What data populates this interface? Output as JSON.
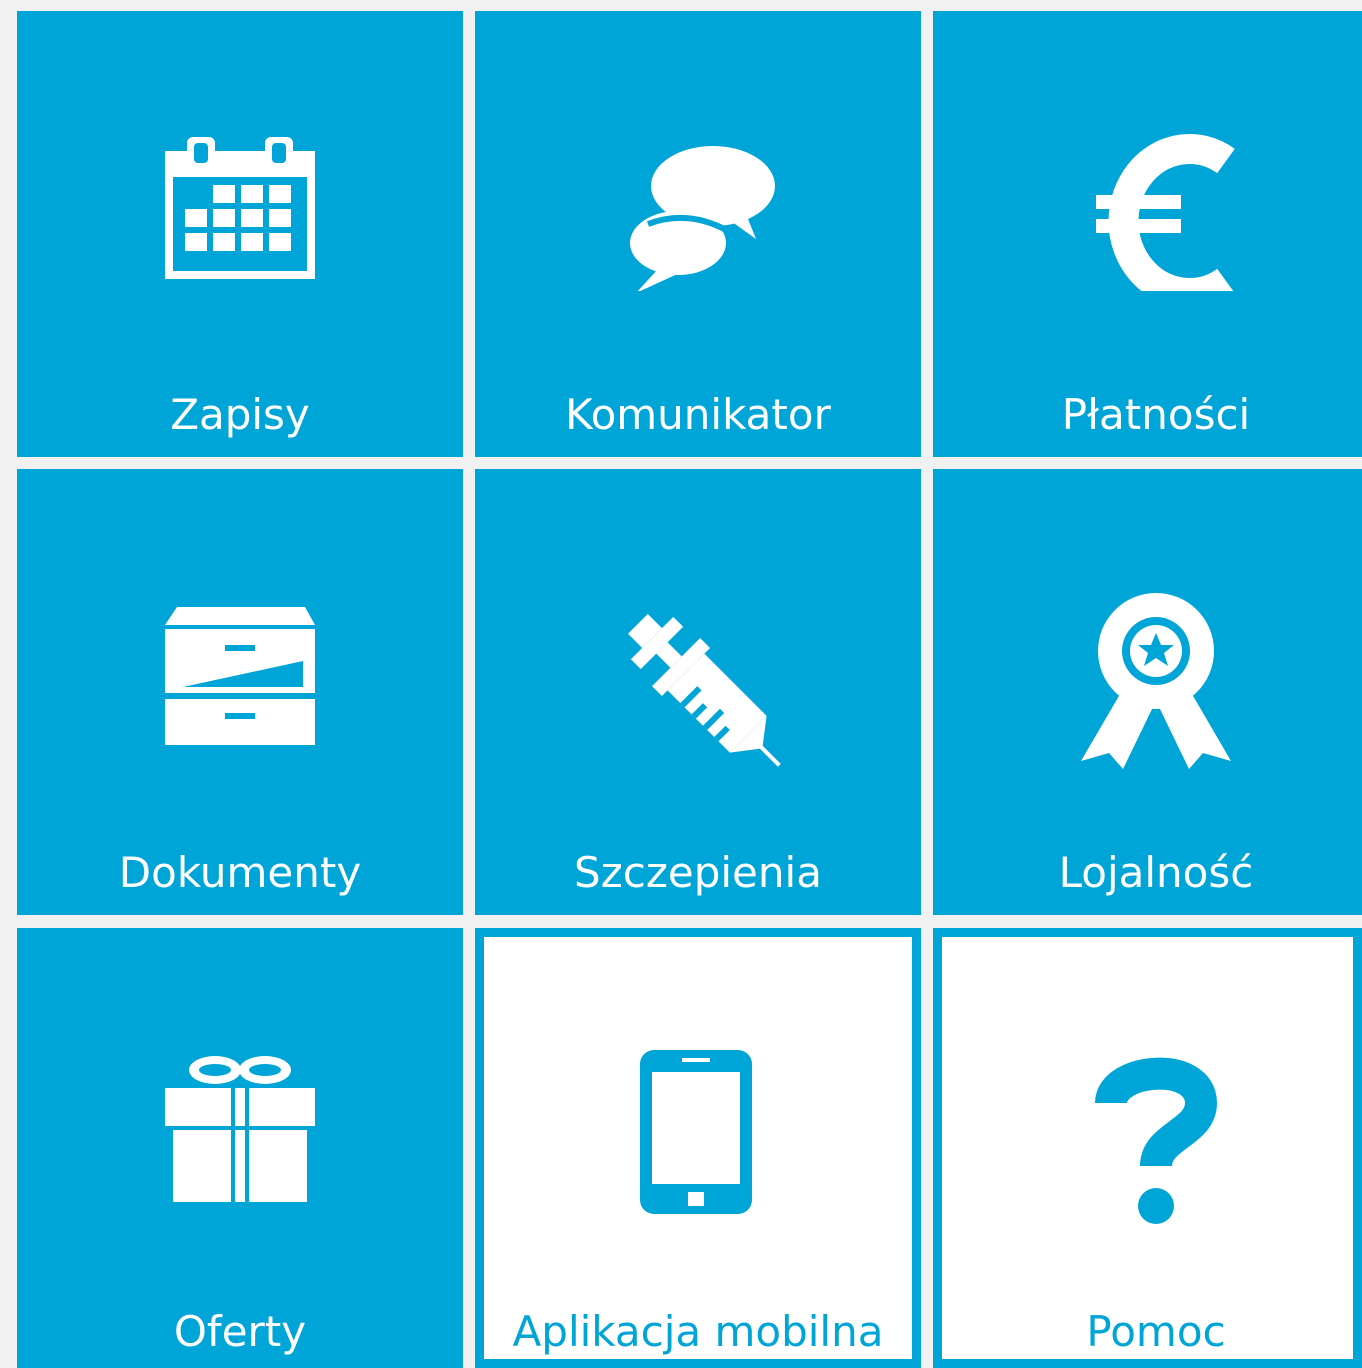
{
  "tiles": [
    {
      "label": "Zapisy",
      "icon": "calendar-icon"
    },
    {
      "label": "Komunikator",
      "icon": "chat-icon"
    },
    {
      "label": "Płatności",
      "icon": "euro-icon"
    },
    {
      "label": "Dokumenty",
      "icon": "file-cabinet-icon"
    },
    {
      "label": "Szczepienia",
      "icon": "syringe-icon"
    },
    {
      "label": "Lojalność",
      "icon": "award-ribbon-icon"
    },
    {
      "label": "Oferty",
      "icon": "gift-icon"
    },
    {
      "label": "Aplikacja mobilna",
      "icon": "mobile-phone-icon"
    },
    {
      "label": "Pomoc",
      "icon": "question-mark-icon"
    }
  ],
  "colors": {
    "accent": "#00a5d7",
    "tile_text": "#ffffff",
    "background": "#f1f1f1",
    "outline_tile_background": "#ffffff"
  }
}
